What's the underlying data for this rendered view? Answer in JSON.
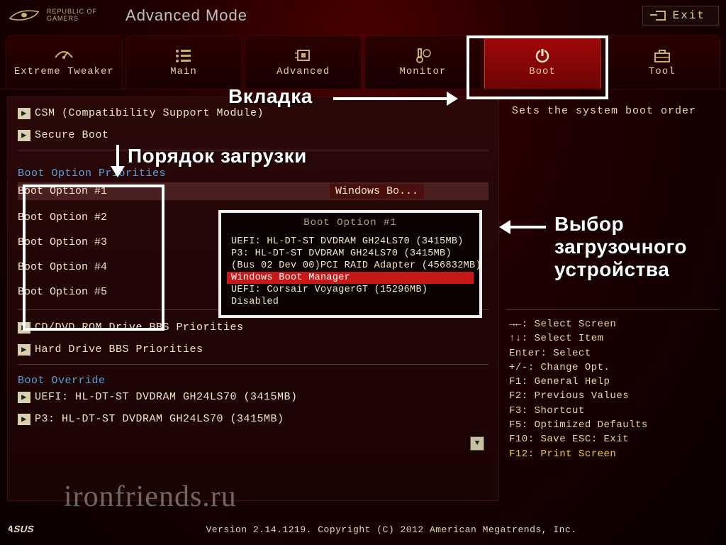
{
  "header": {
    "brand_line1": "REPUBLIC OF",
    "brand_line2": "GAMERS",
    "mode_title": "Advanced Mode",
    "exit_label": "Exit"
  },
  "tabs": [
    {
      "label": "Extreme Tweaker"
    },
    {
      "label": "Main"
    },
    {
      "label": "Advanced"
    },
    {
      "label": "Monitor"
    },
    {
      "label": "Boot"
    },
    {
      "label": "Tool"
    }
  ],
  "left": {
    "csm": "CSM (Compatibility Support Module)",
    "secure_boot": "Secure Boot",
    "priorities_heading": "Boot Option Priorities",
    "options": [
      {
        "label": "Boot Option #1",
        "value": "Windows Bo..."
      },
      {
        "label": "Boot Option #2",
        "value": ""
      },
      {
        "label": "Boot Option #3",
        "value": ""
      },
      {
        "label": "Boot Option #4",
        "value": ""
      },
      {
        "label": "Boot Option #5",
        "value": ""
      }
    ],
    "cdrom_bbs": "CD/DVD ROM Drive BBS Priorities",
    "hdd_bbs": "Hard Drive BBS Priorities",
    "override_heading": "Boot Override",
    "override": [
      "UEFI: HL-DT-ST DVDRAM GH24LS70 (3415MB)",
      "P3: HL-DT-ST DVDRAM GH24LS70  (3415MB)"
    ]
  },
  "popup": {
    "title": "Boot Option #1",
    "items": [
      "UEFI: HL-DT-ST DVDRAM GH24LS70 (3415MB)",
      "P3: HL-DT-ST DVDRAM GH24LS70  (3415MB)",
      "(Bus 02 Dev 00)PCI RAID Adapter  (456832MB)",
      "Windows Boot Manager",
      "UEFI: Corsair VoyagerGT (15296MB)",
      "Disabled"
    ],
    "selected_index": 3
  },
  "help": {
    "text": "Sets the system boot order"
  },
  "hotkeys": {
    "l0": "→←: Select Screen",
    "l1": "↑↓: Select Item",
    "l2": "Enter: Select",
    "l3": "+/-: Change Opt.",
    "l4": "F1: General Help",
    "l5": "F2: Previous Values",
    "l6": "F3: Shortcut",
    "l7": "F5: Optimized Defaults",
    "l8": "F10: Save  ESC: Exit",
    "l9": "F12: Print Screen"
  },
  "footer": {
    "copyright": "Version 2.14.1219. Copyright (C) 2012 American Megatrends, Inc."
  },
  "annotations": {
    "tab_label": "Вкладка",
    "order_label": "Порядок загрузки",
    "device_label_l1": "Выбор",
    "device_label_l2": "загрузочного",
    "device_label_l3": "устройства"
  },
  "watermark": "ironfriends.ru"
}
